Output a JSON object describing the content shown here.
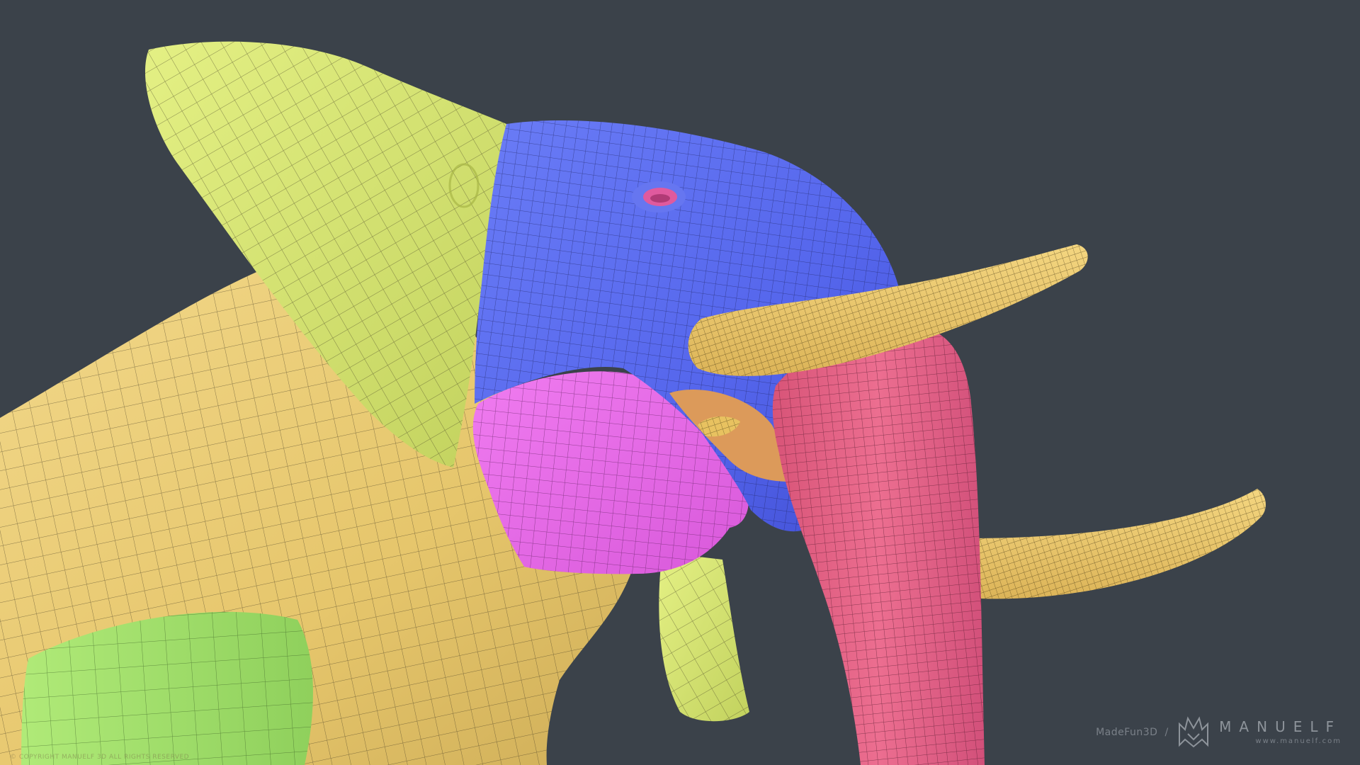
{
  "scene": {
    "background_color": "#3b424a",
    "subject": "elephant",
    "region_colors": {
      "body": "#e8c970",
      "ear": "#d4e46e",
      "head": "#5b6ef0",
      "jaw": "#ea68ea",
      "trunk": "#e66688",
      "tusk": "#ecc868",
      "leg": "#a2e06c",
      "mouth": "#dc9a5a",
      "eye": "#e05a9e",
      "wire": "#3a3320"
    }
  },
  "watermark": {
    "studio": "MadeFun3D",
    "separator": "/",
    "brand": "MANUELF",
    "url": "www.manuelf.com",
    "copyright": "© COPYRIGHT MANUELF 3D ALL RIGHTS RESERVED"
  }
}
